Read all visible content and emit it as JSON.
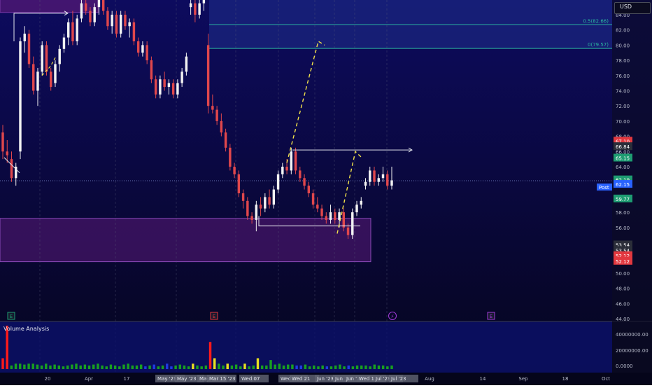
{
  "currency_button": "USD",
  "volume_panel_label": "Volume Analysis",
  "colors": {
    "background_top": "#0c0a55",
    "background_bottom": "#040418",
    "up_candle": "#f2f2f2",
    "down_candle": "#e0474c",
    "fib_zone": "#1f2f8c",
    "demand_zone": "#5a1a78",
    "accent_green": "#1e9c72",
    "accent_red": "#e2383f",
    "accent_blue": "#2962ff",
    "dashed_projection": "#f2e24a"
  },
  "chart_data": {
    "type": "candlestick",
    "title": "",
    "ylim": [
      44,
      85
    ],
    "y_ticks": [
      "84.00",
      "82.00",
      "80.00",
      "78.00",
      "76.00",
      "74.00",
      "72.00",
      "70.00",
      "68.00",
      "66.00",
      "64.00",
      "62.00",
      "60.00",
      "58.00",
      "56.00",
      "54.00",
      "52.00",
      "50.00",
      "48.00",
      "46.00",
      "44.00"
    ],
    "x_ticks": [
      "20",
      "Apr",
      "17",
      "May",
      "15",
      "Jun",
      "Jul",
      "Aug",
      "14",
      "Sep",
      "18",
      "Oct"
    ],
    "x_ticks_overlay": [
      "May '23",
      "May '23",
      "May '23",
      "Mar 15 '23",
      "Wed 07",
      "Wed 07",
      "Wed 21",
      "Jun '23",
      "Jun '23",
      "Jun '23",
      "Wed 12",
      "Jul '23",
      "Jul '23"
    ],
    "fib_levels": [
      {
        "label": "0.5(82.66)",
        "value": 82.66
      },
      {
        "label": "0(79.57)",
        "value": 79.57
      }
    ],
    "price_labels": [
      {
        "value": 67.1,
        "text": "67.10",
        "color": "#e2383f"
      },
      {
        "value": 66.84,
        "text": "66.84",
        "color": "#2b2e39"
      },
      {
        "value": 65.15,
        "text": "65.15",
        "color": "#1e9c72"
      },
      {
        "value": 62.19,
        "text": "62.19",
        "color": "#1e9c72"
      },
      {
        "value": 62.15,
        "text": "62.15",
        "color": "#2962ff"
      },
      {
        "value": 59.77,
        "text": "59.77",
        "color": "#1e9c72"
      },
      {
        "value": 53.54,
        "text": "53.54",
        "color": "#2b2e39"
      },
      {
        "value": 53.54,
        "text": "53.54",
        "color": "#2b2e39"
      },
      {
        "value": 52.12,
        "text": "52.12",
        "color": "#e2383f"
      },
      {
        "value": 52.12,
        "text": "52.12",
        "color": "#e2383f"
      }
    ],
    "post_label": "Post",
    "current_price": 62.15,
    "volume_ticks": [
      "40000000.00",
      "20000000.00",
      "0.0000"
    ],
    "volume_ylim": [
      0,
      48000000
    ],
    "event_markers": [
      {
        "label": "E",
        "kind": "earnings",
        "color": "#1e9c72"
      },
      {
        "label": "E",
        "kind": "earnings",
        "color": "#e2383f"
      },
      {
        "label": "⚡",
        "kind": "split",
        "color": "#a23bd8"
      },
      {
        "label": "E",
        "kind": "earnings",
        "color": "#a23bd8"
      }
    ],
    "candles": [
      [
        68.5,
        69.5,
        65.0,
        66.0
      ],
      [
        66.0,
        67.5,
        64.5,
        65.5
      ],
      [
        65.0,
        66.0,
        62.0,
        62.5
      ],
      [
        62.5,
        64.5,
        61.5,
        64.0
      ],
      [
        66.0,
        81.0,
        65.0,
        80.5
      ],
      [
        80.5,
        82.5,
        79.0,
        81.5
      ],
      [
        81.5,
        82.0,
        77.0,
        77.5
      ],
      [
        77.5,
        78.5,
        73.5,
        74.0
      ],
      [
        74.0,
        77.0,
        72.0,
        76.5
      ],
      [
        76.5,
        80.5,
        76.0,
        80.0
      ],
      [
        80.0,
        80.5,
        76.0,
        76.5
      ],
      [
        76.5,
        77.0,
        74.0,
        74.5
      ],
      [
        75.0,
        78.0,
        74.5,
        77.5
      ],
      [
        77.5,
        80.0,
        76.5,
        79.5
      ],
      [
        79.5,
        81.5,
        79.0,
        81.0
      ],
      [
        81.0,
        83.5,
        80.0,
        83.0
      ],
      [
        83.0,
        84.5,
        80.0,
        80.5
      ],
      [
        80.5,
        84.0,
        80.0,
        83.5
      ],
      [
        83.5,
        86.0,
        83.0,
        85.5
      ],
      [
        85.5,
        87.0,
        84.0,
        84.5
      ],
      [
        84.5,
        85.0,
        82.5,
        83.0
      ],
      [
        83.0,
        85.5,
        82.5,
        85.0
      ],
      [
        85.0,
        86.5,
        84.0,
        86.0
      ],
      [
        86.0,
        86.5,
        84.0,
        84.5
      ],
      [
        84.5,
        85.0,
        82.0,
        82.5
      ],
      [
        82.5,
        84.5,
        81.5,
        84.0
      ],
      [
        84.0,
        84.5,
        81.0,
        81.5
      ],
      [
        81.5,
        84.5,
        81.0,
        84.0
      ],
      [
        84.0,
        84.5,
        82.0,
        82.5
      ],
      [
        82.5,
        83.5,
        81.0,
        83.0
      ],
      [
        83.0,
        83.5,
        80.0,
        80.5
      ],
      [
        80.5,
        81.0,
        78.5,
        79.0
      ],
      [
        79.0,
        80.5,
        78.5,
        80.0
      ],
      [
        80.0,
        80.5,
        77.5,
        78.0
      ],
      [
        78.0,
        78.5,
        75.0,
        75.5
      ],
      [
        75.5,
        76.0,
        73.0,
        73.5
      ],
      [
        73.5,
        76.0,
        73.0,
        75.5
      ],
      [
        75.5,
        76.5,
        74.0,
        74.5
      ],
      [
        74.5,
        75.5,
        73.5,
        75.0
      ],
      [
        75.0,
        75.5,
        73.0,
        73.5
      ],
      [
        73.5,
        75.5,
        73.0,
        75.0
      ],
      [
        75.0,
        77.0,
        74.5,
        76.5
      ],
      [
        76.5,
        79.0,
        76.0,
        78.5
      ],
      [
        85.0,
        86.0,
        84.0,
        85.5
      ],
      [
        85.5,
        86.5,
        83.0,
        84.0
      ],
      [
        84.0,
        86.0,
        83.5,
        85.5
      ],
      [
        85.5,
        86.5,
        84.5,
        86.0
      ],
      [
        80.0,
        81.5,
        71.0,
        72.0
      ],
      [
        72.0,
        73.5,
        71.0,
        71.5
      ],
      [
        71.5,
        72.0,
        69.5,
        70.0
      ],
      [
        70.0,
        71.0,
        68.0,
        68.5
      ],
      [
        68.5,
        69.0,
        66.0,
        66.5
      ],
      [
        66.5,
        67.0,
        63.5,
        64.0
      ],
      [
        64.0,
        64.5,
        62.5,
        63.0
      ],
      [
        63.0,
        63.5,
        60.0,
        60.5
      ],
      [
        60.5,
        61.0,
        58.5,
        59.5
      ],
      [
        59.5,
        60.0,
        57.0,
        57.5
      ],
      [
        57.5,
        58.0,
        56.5,
        57.0
      ],
      [
        57.0,
        59.5,
        55.5,
        59.0
      ],
      [
        59.0,
        60.0,
        57.5,
        58.5
      ],
      [
        58.5,
        60.5,
        58.0,
        60.0
      ],
      [
        60.0,
        61.0,
        58.5,
        59.0
      ],
      [
        59.0,
        61.5,
        58.5,
        61.0
      ],
      [
        61.0,
        63.5,
        60.5,
        63.0
      ],
      [
        63.0,
        64.5,
        62.5,
        64.0
      ],
      [
        64.0,
        65.0,
        63.0,
        63.5
      ],
      [
        63.5,
        66.5,
        63.0,
        66.0
      ],
      [
        66.0,
        66.5,
        63.0,
        63.5
      ],
      [
        63.5,
        64.0,
        62.0,
        62.5
      ],
      [
        62.5,
        63.0,
        61.0,
        61.5
      ],
      [
        61.5,
        62.0,
        60.0,
        60.5
      ],
      [
        60.5,
        61.0,
        58.5,
        59.0
      ],
      [
        59.0,
        60.0,
        58.0,
        58.5
      ],
      [
        58.5,
        59.0,
        57.0,
        57.5
      ],
      [
        57.5,
        58.0,
        56.5,
        57.0
      ],
      [
        57.0,
        59.0,
        56.5,
        58.0
      ],
      [
        58.0,
        58.5,
        56.5,
        57.0
      ],
      [
        57.0,
        58.5,
        56.0,
        58.0
      ],
      [
        58.0,
        58.5,
        55.5,
        56.0
      ],
      [
        56.0,
        56.5,
        54.5,
        55.0
      ],
      [
        55.0,
        58.5,
        54.5,
        58.0
      ],
      [
        58.0,
        59.5,
        57.5,
        59.0
      ],
      [
        59.0,
        60.0,
        58.5,
        59.5
      ],
      [
        61.5,
        62.5,
        61.0,
        62.0
      ],
      [
        62.0,
        64.0,
        61.5,
        63.5
      ],
      [
        63.5,
        64.0,
        61.5,
        62.0
      ],
      [
        62.0,
        63.0,
        61.5,
        62.5
      ],
      [
        62.5,
        64.0,
        62.0,
        63.0
      ],
      [
        63.0,
        63.5,
        61.0,
        61.5
      ],
      [
        61.5,
        64.0,
        61.0,
        62.2
      ]
    ],
    "volumes": [
      12,
      48,
      4,
      6,
      6,
      5,
      6,
      6,
      5,
      4,
      6,
      4,
      5,
      4,
      3,
      4,
      5,
      6,
      4,
      5,
      4,
      5,
      6,
      4,
      3,
      5,
      4,
      3,
      5,
      6,
      4,
      4,
      5,
      3,
      4,
      5,
      3,
      4,
      6,
      3,
      4,
      5,
      4,
      3,
      6,
      4,
      3,
      4,
      30,
      12,
      6,
      4,
      6,
      4,
      5,
      3,
      6,
      3,
      4,
      12,
      4,
      4,
      10,
      5,
      6,
      4,
      5,
      5,
      4,
      4,
      5,
      3,
      4,
      3,
      4,
      3,
      3,
      4,
      5,
      3,
      4,
      3,
      4,
      4,
      4,
      3,
      5,
      4,
      4,
      3,
      4
    ],
    "volume_colors": [
      "r",
      "r",
      "g",
      "g",
      "g",
      "g",
      "g",
      "g",
      "g",
      "g",
      "g",
      "g",
      "g",
      "g",
      "g",
      "g",
      "g",
      "g",
      "g",
      "g",
      "g",
      "g",
      "g",
      "g",
      "g",
      "g",
      "g",
      "g",
      "g",
      "g",
      "g",
      "g",
      "g",
      "b",
      "g",
      "b",
      "g",
      "g",
      "b",
      "b",
      "g",
      "g",
      "g",
      "g",
      "y",
      "g",
      "g",
      "g",
      "r",
      "y",
      "g",
      "g",
      "y",
      "g",
      "g",
      "g",
      "y",
      "g",
      "g",
      "y",
      "g",
      "g",
      "g",
      "g",
      "g",
      "g",
      "g",
      "g",
      "b",
      "b",
      "g",
      "g",
      "g",
      "g",
      "g",
      "b",
      "g",
      "g",
      "g",
      "g",
      "b",
      "g",
      "g",
      "g",
      "g",
      "g",
      "g",
      "g",
      "g",
      "g",
      "g"
    ]
  }
}
